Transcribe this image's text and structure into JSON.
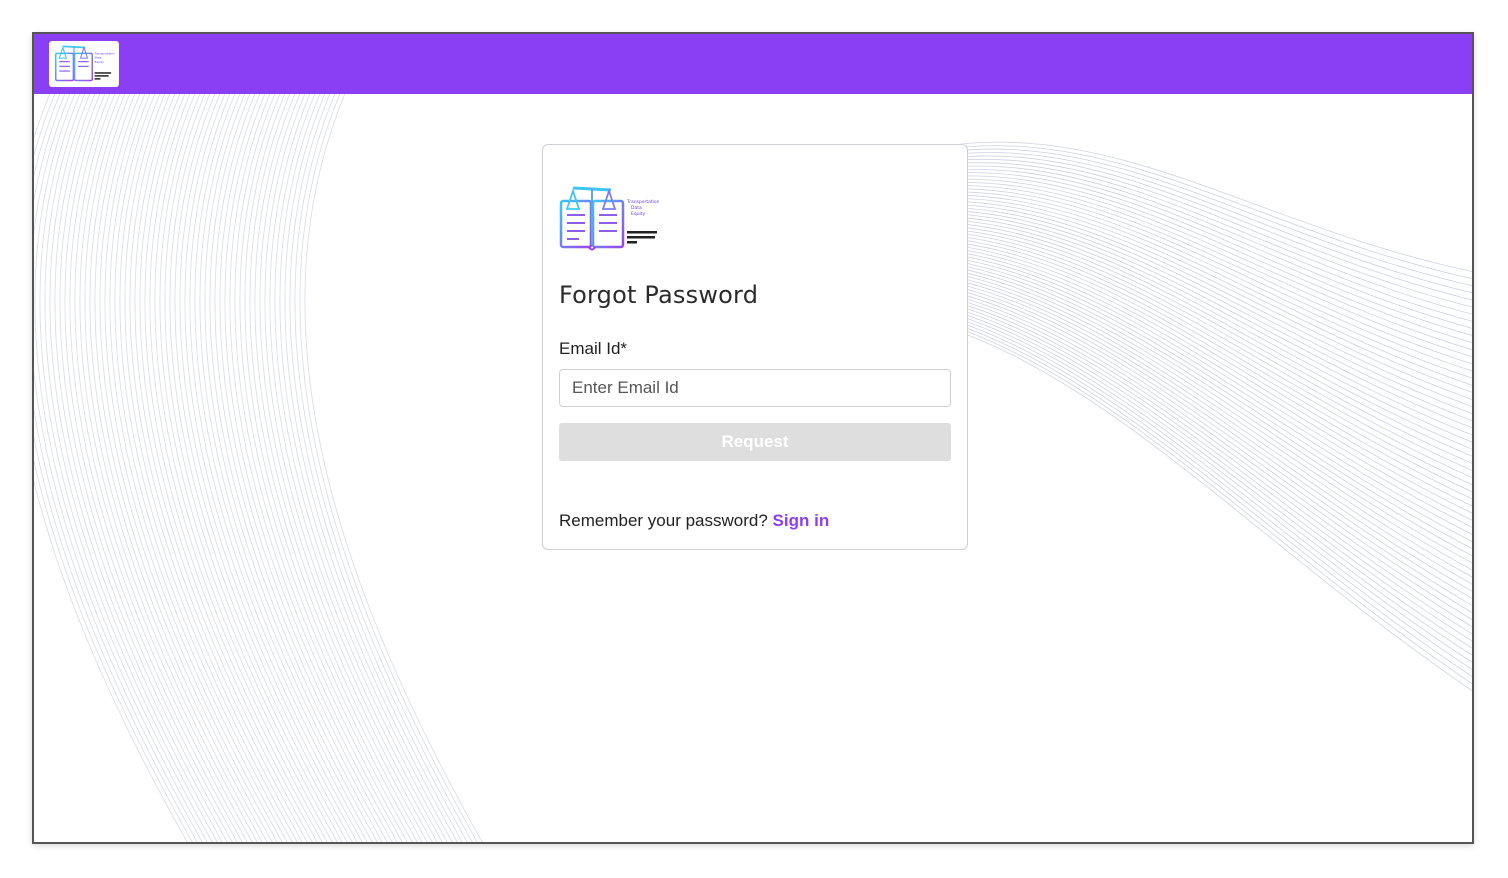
{
  "header": {
    "logo_icon": "justice-scales-book-logo-icon",
    "brand_color": "#8a3ff4"
  },
  "card": {
    "logo_icon": "justice-scales-book-logo-icon",
    "title": "Forgot Password",
    "email_label": "Email Id*",
    "email_placeholder": "Enter Email Id",
    "email_value": "",
    "request_label": "Request",
    "remember_text": "Remember your password?",
    "signin_label": "Sign in"
  },
  "colors": {
    "accent": "#8a3ff4",
    "button_disabled": "#dedede",
    "card_border": "#cfcfd4"
  }
}
